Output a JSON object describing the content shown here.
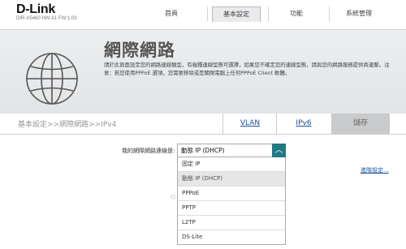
{
  "brand": {
    "logo": "D-Link",
    "model": "DIR-X5460 HW:A1 FW:1.03"
  },
  "nav": [
    {
      "label": "首頁"
    },
    {
      "label": "基本設定",
      "active": true
    },
    {
      "label": "功能"
    },
    {
      "label": "系統管理"
    }
  ],
  "page": {
    "title": "網際網路",
    "description": "請於此頁面設定您的網路連線類型，有幾種連線型態可選擇，如果您不確定您的連線型態，請與您的網路服務提供商連繫。注意：若您使用PPPoE 選項，您需要移除或是關閉電腦上任何PPPoE Client 軟體。",
    "breadcrumb": "基本設定>>網際網路>>IPv4",
    "tabs": {
      "vlan": "VLAN",
      "ipv6": "IPv6",
      "save": "儲存"
    }
  },
  "form": {
    "label": "我的網際網路連線是:",
    "selected": "動態 IP (DHCP)",
    "options": [
      "固定 IP",
      "動態 IP (DHCP)",
      "PPPoE",
      "PPTP",
      "L2TP",
      "DS-Lite"
    ],
    "advanced": "進階設定..."
  },
  "partial_text": "Cl"
}
